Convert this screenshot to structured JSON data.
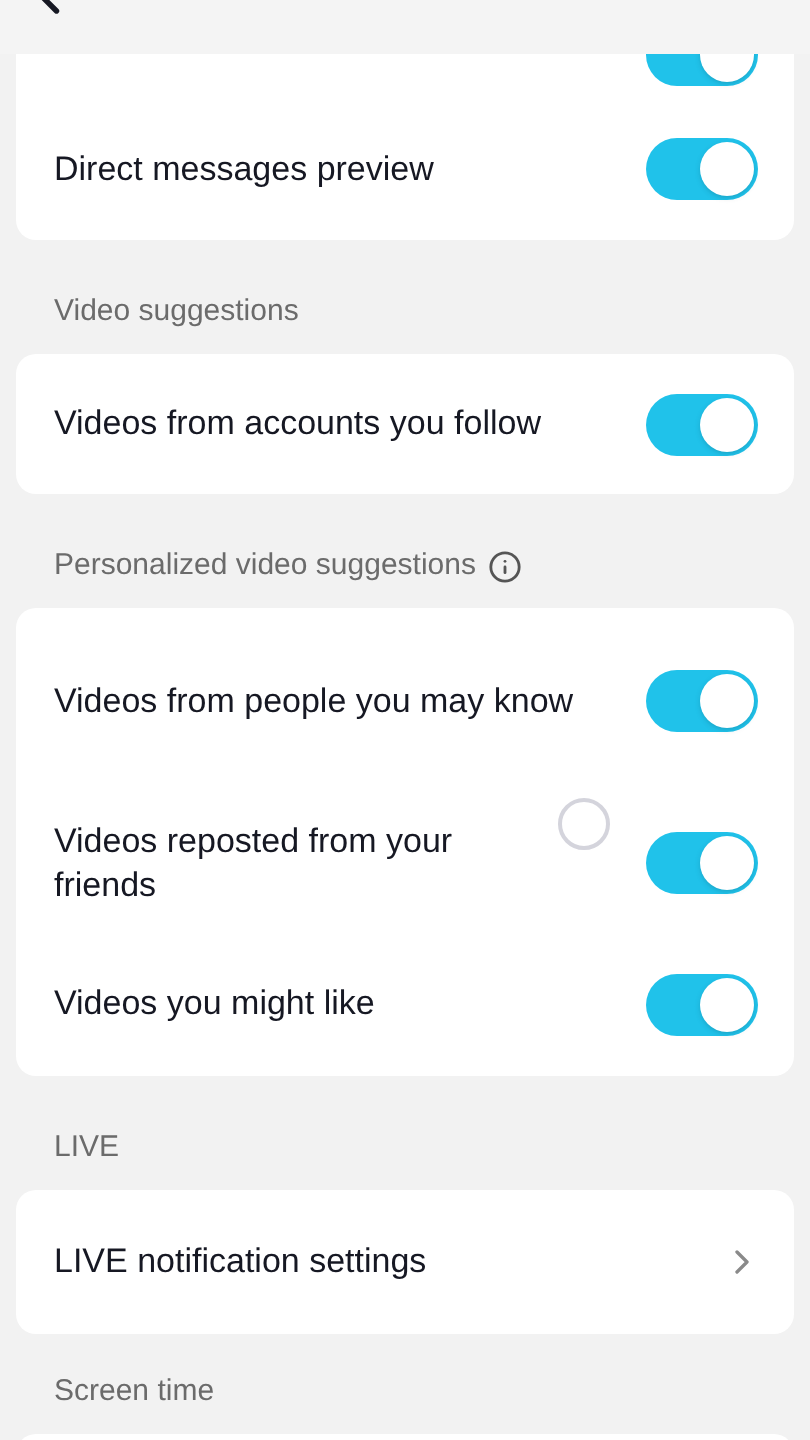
{
  "sections": [
    {
      "rows": [
        {
          "kind": "toggle",
          "on": true
        },
        {
          "kind": "toggle",
          "label": "Direct messages preview",
          "on": true
        }
      ]
    },
    {
      "label": "Video suggestions",
      "rows": [
        {
          "kind": "toggle",
          "label": "Videos from accounts you follow",
          "on": true
        }
      ]
    },
    {
      "label": "Personalized video suggestions",
      "info": true,
      "rows": [
        {
          "kind": "toggle",
          "label": "Videos from people you may know",
          "on": true
        },
        {
          "kind": "toggle",
          "label": "Videos reposted from your friends",
          "on": true,
          "touch": true
        },
        {
          "kind": "toggle",
          "label": "Videos you might like",
          "on": true
        }
      ]
    },
    {
      "label": "LIVE",
      "rows": [
        {
          "kind": "link",
          "label": "LIVE notification settings"
        }
      ]
    },
    {
      "label": "Screen time"
    }
  ]
}
